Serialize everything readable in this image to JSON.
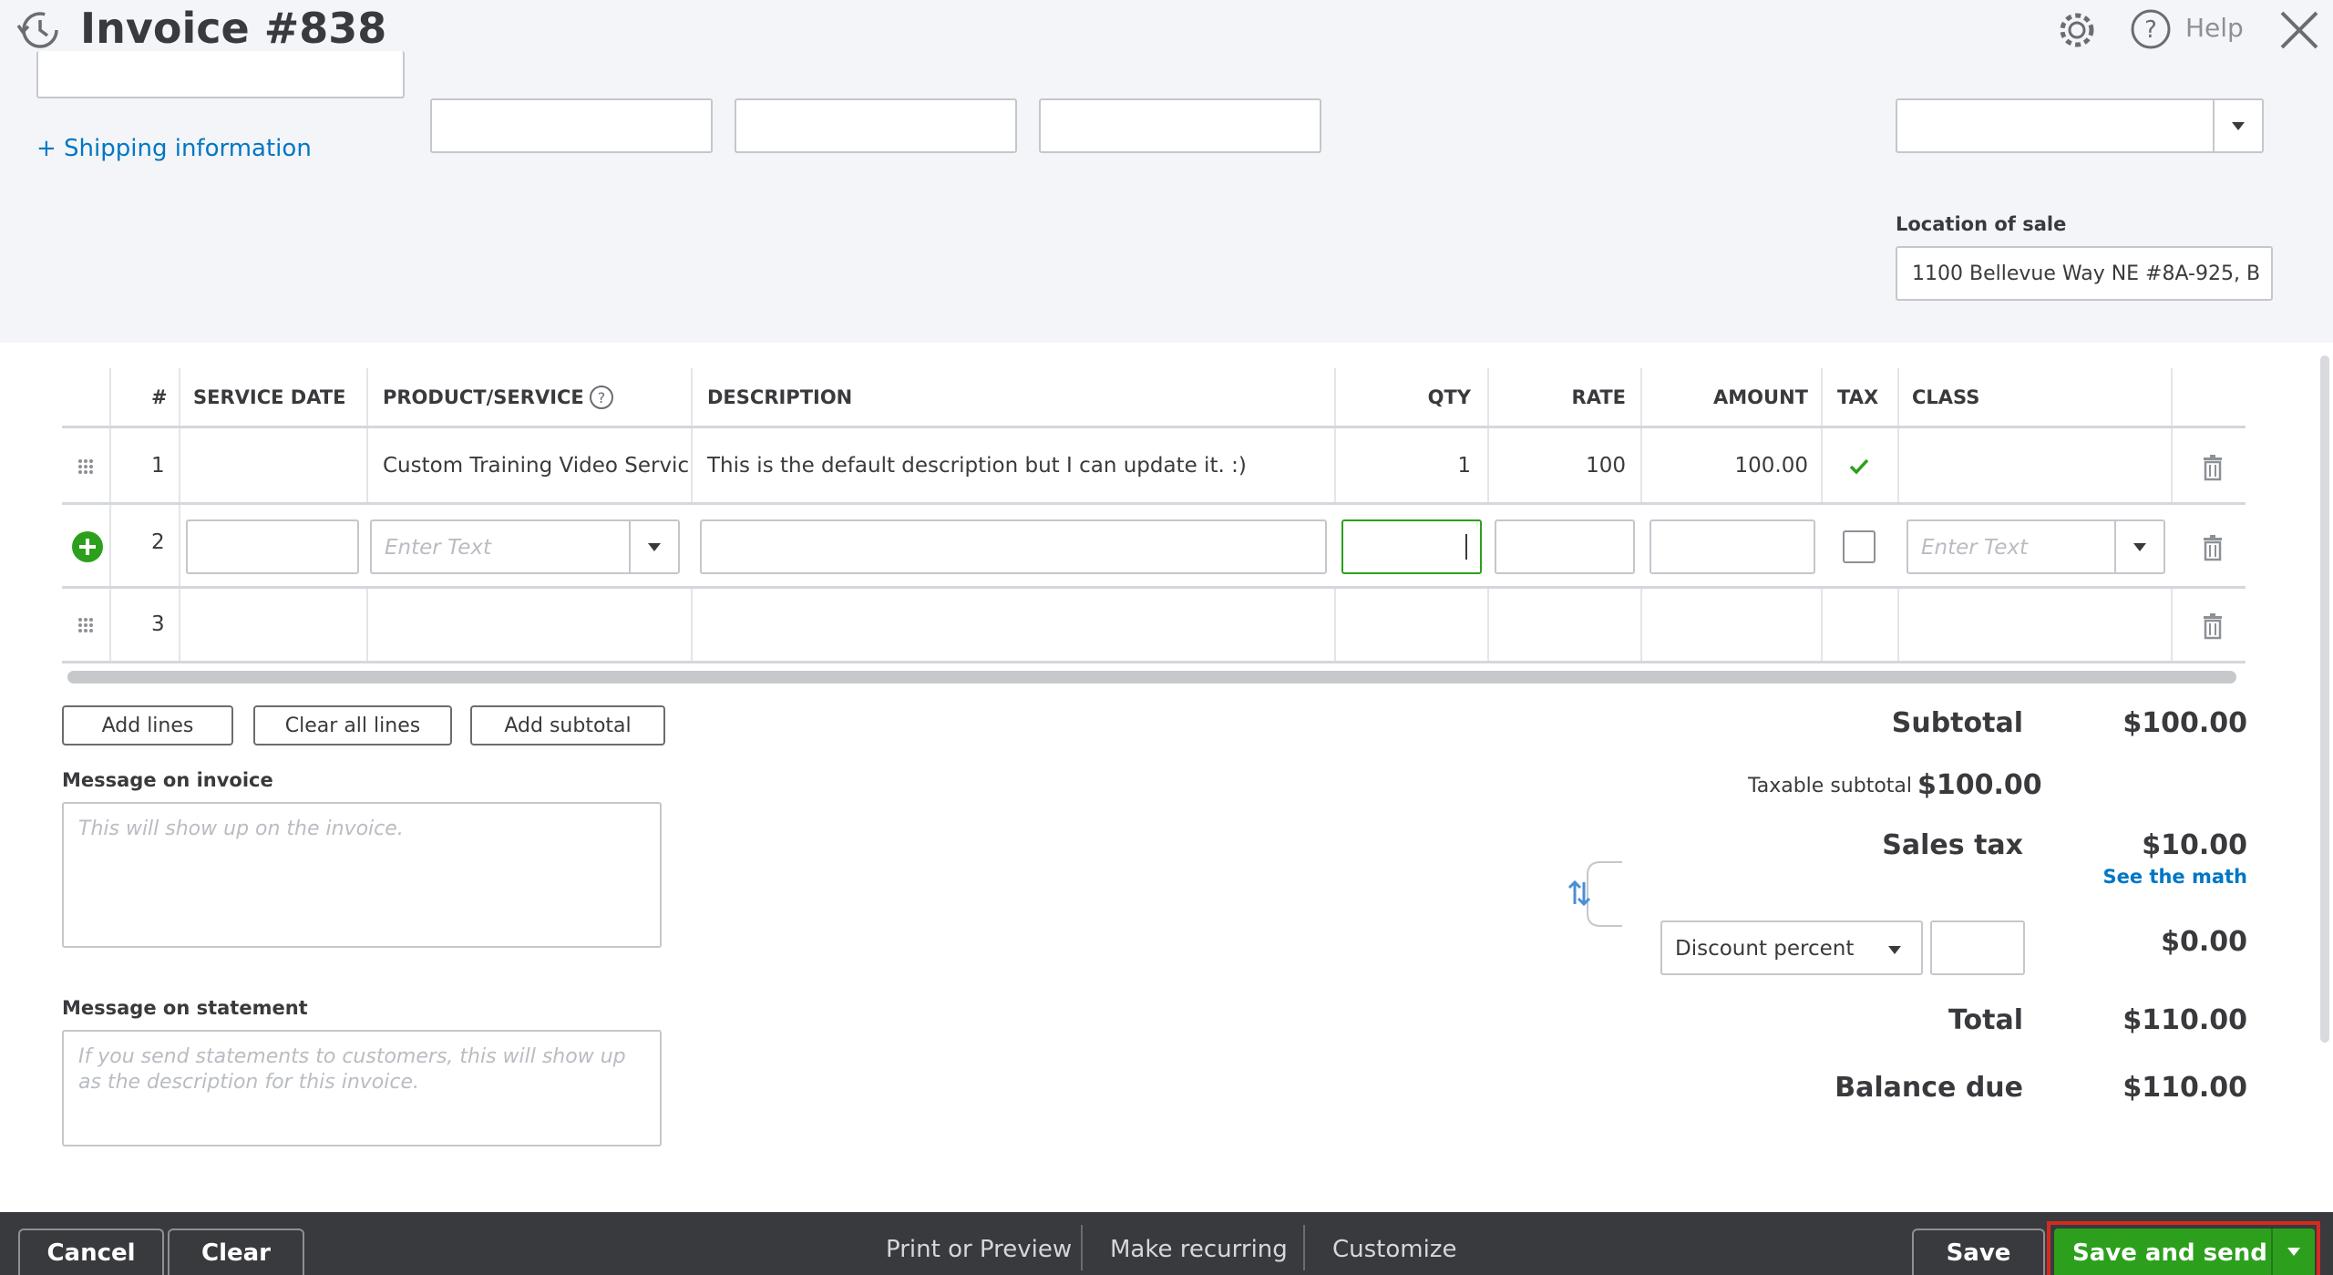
{
  "header": {
    "title": "Invoice #838",
    "help_label": "Help"
  },
  "top": {
    "shipping_link": "+ Shipping information",
    "location_label": "Location of sale",
    "location_value": "1100 Bellevue Way NE #8A-925, B"
  },
  "table": {
    "columns": [
      "#",
      "SERVICE DATE",
      "PRODUCT/SERVICE",
      "DESCRIPTION",
      "QTY",
      "RATE",
      "AMOUNT",
      "TAX",
      "CLASS"
    ],
    "rows": [
      {
        "num": "1",
        "service_date": "",
        "product": "Custom Training Video Service",
        "description": "This is the default description but I can update it. :)",
        "qty": "1",
        "rate": "100",
        "amount": "100.00",
        "tax": true,
        "class": ""
      },
      {
        "num": "2",
        "product_placeholder": "Enter Text",
        "class_placeholder": "Enter Text"
      },
      {
        "num": "3"
      }
    ]
  },
  "actions": {
    "add_lines": "Add lines",
    "clear_all_lines": "Clear all lines",
    "add_subtotal": "Add subtotal"
  },
  "messages": {
    "invoice_label": "Message on invoice",
    "invoice_placeholder": "This will show up on the invoice.",
    "statement_label": "Message on statement",
    "statement_placeholder": "If you send statements to customers, this will show up as the description for this invoice."
  },
  "totals": {
    "subtotal_label": "Subtotal",
    "subtotal_value": "$100.00",
    "taxable_label": "Taxable subtotal",
    "taxable_value": "$100.00",
    "sales_tax_label": "Sales tax",
    "sales_tax_value": "$10.00",
    "see_math": "See the math",
    "discount_type": "Discount percent",
    "discount_value": "$0.00",
    "total_label": "Total",
    "total_value": "$110.00",
    "balance_label": "Balance due",
    "balance_value": "$110.00"
  },
  "footer": {
    "cancel": "Cancel",
    "clear": "Clear",
    "print_preview": "Print or Preview",
    "make_recurring": "Make recurring",
    "customize": "Customize",
    "save": "Save",
    "save_and_send": "Save and send"
  },
  "colors": {
    "accent_green": "#2ca01c",
    "link_blue": "#0077c5",
    "highlight_red": "#d52b1e",
    "footer_bg": "#393a3d"
  }
}
